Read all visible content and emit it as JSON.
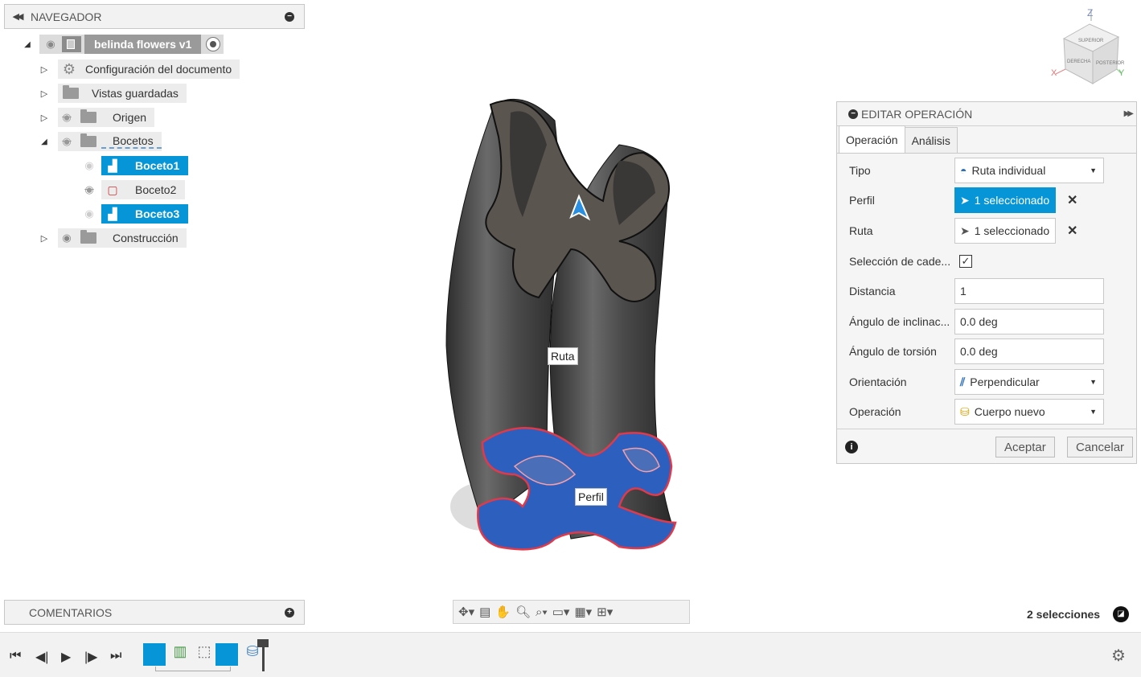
{
  "navigator": {
    "title": "NAVEGADOR",
    "root": "belinda flowers v1",
    "items": [
      {
        "label": "Configuración del documento"
      },
      {
        "label": "Vistas guardadas"
      },
      {
        "label": "Origen"
      },
      {
        "label": "Bocetos"
      },
      {
        "label": "Boceto1"
      },
      {
        "label": "Boceto2"
      },
      {
        "label": "Boceto3"
      },
      {
        "label": "Construcción"
      }
    ]
  },
  "viewport": {
    "ruta_label": "Ruta",
    "perfil_label": "Perfil",
    "viewcube": {
      "z": "Z",
      "x": "X",
      "y": "Y",
      "faces": [
        "SUPERIOR",
        "DERECHA",
        "POSTERIOR"
      ]
    }
  },
  "panel": {
    "title": "EDITAR OPERACIÓN",
    "tabs": [
      "Operación",
      "Análisis"
    ],
    "rows": {
      "tipo": {
        "label": "Tipo",
        "value": "Ruta individual"
      },
      "perfil": {
        "label": "Perfil",
        "value": "1 seleccionado"
      },
      "ruta": {
        "label": "Ruta",
        "value": "1 seleccionado"
      },
      "cadena": {
        "label": "Selección de cade..."
      },
      "distancia": {
        "label": "Distancia",
        "value": "1"
      },
      "inclinacion": {
        "label": "Ángulo de inclinac...",
        "value": "0.0 deg"
      },
      "torsion": {
        "label": "Ángulo de torsión",
        "value": "0.0 deg"
      },
      "orientacion": {
        "label": "Orientación",
        "value": "Perpendicular"
      },
      "operacion": {
        "label": "Operación",
        "value": "Cuerpo nuevo"
      }
    },
    "accept": "Aceptar",
    "cancel": "Cancelar"
  },
  "comments": {
    "title": "COMENTARIOS"
  },
  "status": {
    "selections": "2 selecciones"
  },
  "colors": {
    "accent": "#0696d7",
    "body": "#4a4a4a",
    "profile": "#2d5fbf"
  }
}
